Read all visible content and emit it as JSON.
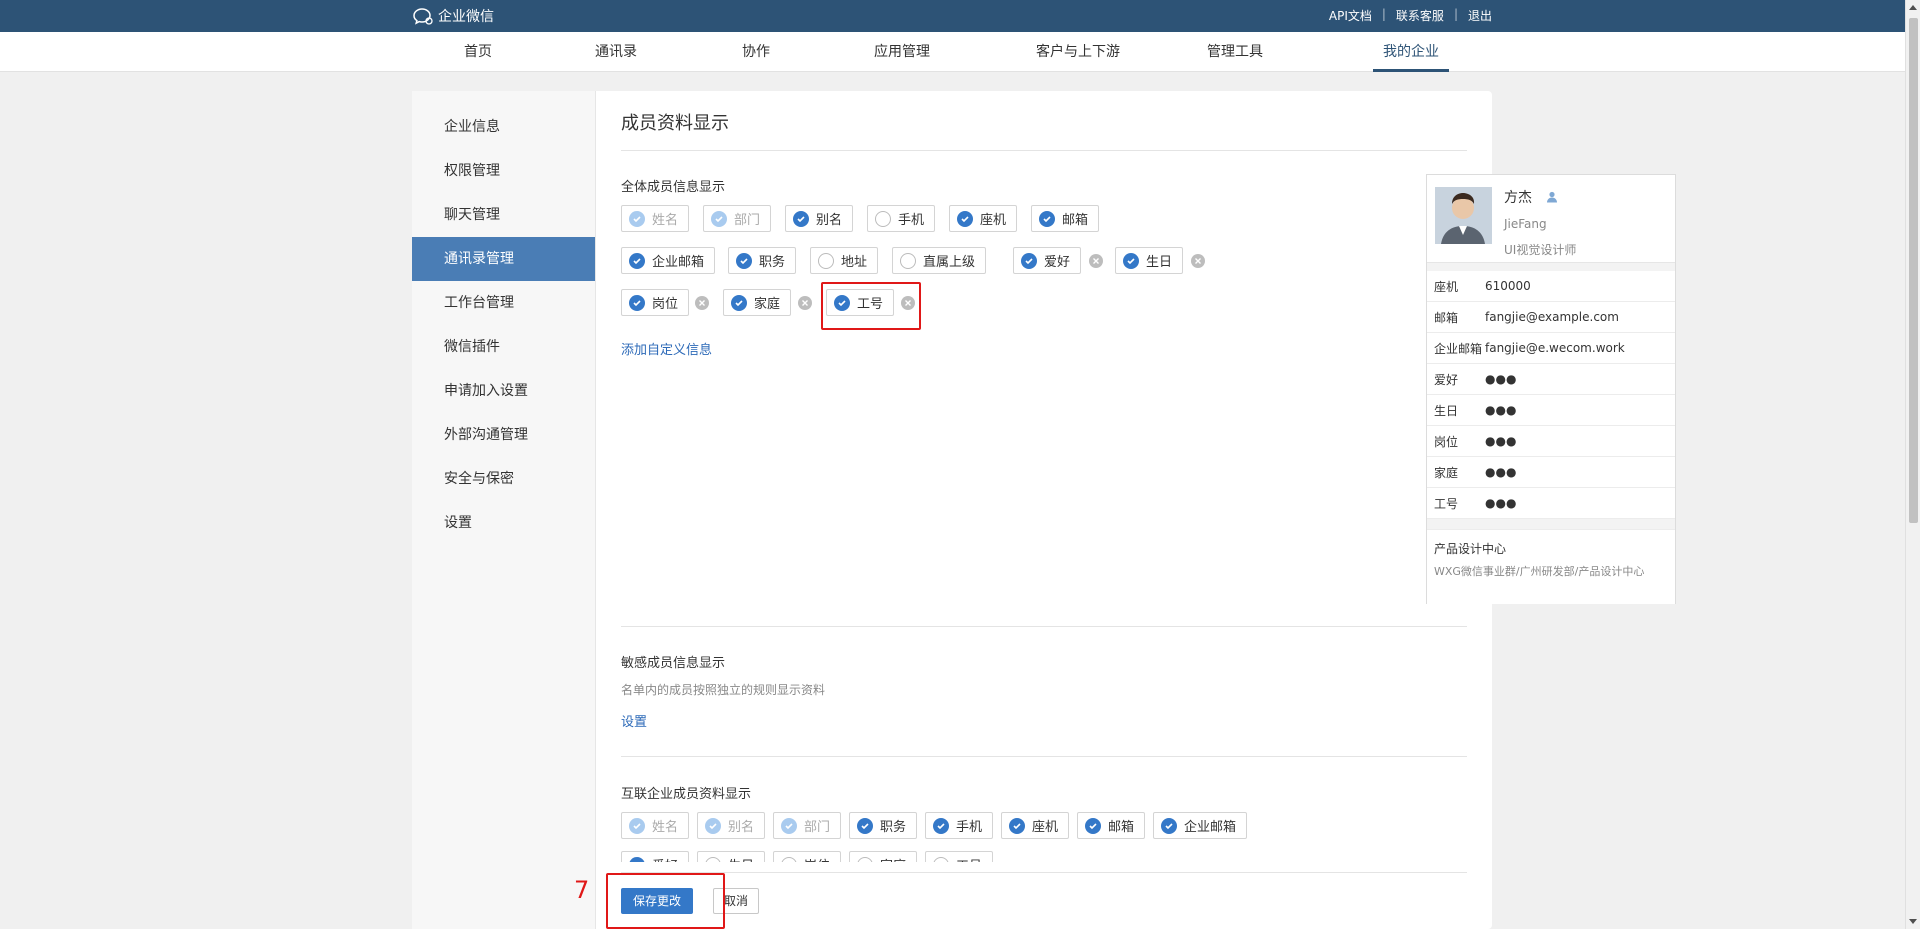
{
  "app": {
    "logo_text": "企业微信"
  },
  "top_links": [
    "API文档",
    "联系客服",
    "退出"
  ],
  "nav": {
    "items": [
      "首页",
      "通讯录",
      "协作",
      "应用管理",
      "客户与上下游",
      "管理工具",
      "我的企业"
    ],
    "active": "我的企业"
  },
  "sidebar": {
    "items": [
      "企业信息",
      "权限管理",
      "聊天管理",
      "通讯录管理",
      "工作台管理",
      "微信插件",
      "申请加入设置",
      "外部沟通管理",
      "安全与保密",
      "设置"
    ],
    "active": "通讯录管理"
  },
  "page": {
    "title": "成员资料显示"
  },
  "all_members": {
    "label": "全体成员信息显示",
    "row1": [
      {
        "label": "姓名",
        "state": "disabled"
      },
      {
        "label": "部门",
        "state": "disabled"
      },
      {
        "label": "别名",
        "state": "checked"
      },
      {
        "label": "手机",
        "state": "unchecked"
      },
      {
        "label": "座机",
        "state": "checked"
      },
      {
        "label": "邮箱",
        "state": "checked"
      }
    ],
    "row2": [
      {
        "label": "企业邮箱",
        "state": "checked"
      },
      {
        "label": "职务",
        "state": "checked"
      },
      {
        "label": "地址",
        "state": "unchecked"
      },
      {
        "label": "直属上级",
        "state": "unchecked"
      },
      {
        "label": "爱好",
        "state": "checked"
      },
      {
        "label": "生日",
        "state": "checked"
      }
    ],
    "row3": [
      {
        "label": "岗位",
        "state": "checked"
      },
      {
        "label": "家庭",
        "state": "checked"
      },
      {
        "label": "工号",
        "state": "checked"
      }
    ],
    "add_custom": "添加自定义信息"
  },
  "preview": {
    "name": "方杰",
    "pinyin": "JieFang",
    "position": "UI视觉设计师",
    "rows": [
      {
        "key": "座机",
        "value": "610000"
      },
      {
        "key": "邮箱",
        "value": "fangjie@example.com"
      },
      {
        "key": "企业邮箱",
        "value": "fangjie@e.wecom.work"
      },
      {
        "key": "爱好",
        "value": "●●●"
      },
      {
        "key": "生日",
        "value": "●●●"
      },
      {
        "key": "岗位",
        "value": "●●●"
      },
      {
        "key": "家庭",
        "value": "●●●"
      },
      {
        "key": "工号",
        "value": "●●●"
      }
    ],
    "dept": "产品设计中心",
    "dept_path": "WXG微信事业群/广州研发部/产品设计中心"
  },
  "sensitive": {
    "label": "敏感成员信息显示",
    "desc": "名单内的成员按照独立的规则显示资料",
    "link": "设置"
  },
  "linked": {
    "label": "互联企业成员资料显示",
    "row1": [
      {
        "label": "姓名",
        "state": "disabled"
      },
      {
        "label": "别名",
        "state": "disabled"
      },
      {
        "label": "部门",
        "state": "disabled"
      },
      {
        "label": "职务",
        "state": "checked"
      },
      {
        "label": "手机",
        "state": "checked"
      },
      {
        "label": "座机",
        "state": "checked"
      },
      {
        "label": "邮箱",
        "state": "checked"
      },
      {
        "label": "企业邮箱",
        "state": "checked"
      }
    ],
    "row2": [
      {
        "label": "爱好",
        "state": "checked"
      },
      {
        "label": "生日",
        "state": "unchecked"
      },
      {
        "label": "岗位",
        "state": "unchecked"
      },
      {
        "label": "家庭",
        "state": "unchecked"
      },
      {
        "label": "工号",
        "state": "unchecked"
      }
    ]
  },
  "footer": {
    "save": "保存更改",
    "cancel": "取消"
  },
  "annotation": {
    "step_number": "7"
  },
  "colors": {
    "topbar": "#2d5376",
    "accent": "#3478c8",
    "sidebar_active": "#4a7db5",
    "highlight": "#e01818"
  }
}
